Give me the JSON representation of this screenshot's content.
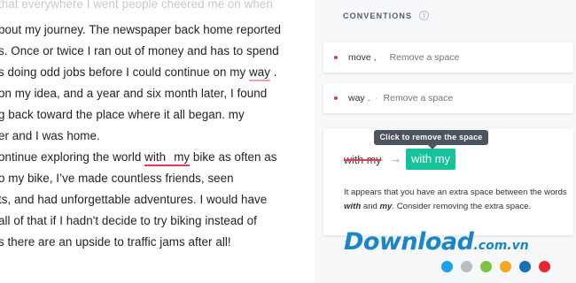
{
  "document": {
    "top_line": "that everywhere I went people cheered me on when",
    "l1": "bout my journey. The newspaper back home reported",
    "l2": "s. Once or twice I ran out of money and has to spend",
    "l3_before": "s doing odd jobs before I could continue on my ",
    "l3_flag": "way",
    "l3_after": " .",
    "l4": "on my idea, and a year and six month later, I found",
    "l5": "g back toward the place where it all began. my",
    "l6": "er and I was home.",
    "l7_before": "ontinue exploring the world ",
    "l7_flag_a": "with",
    "l7_flag_b": "my",
    "l7_after": " bike as often as",
    "l8": "o my bike, I’ve made countless friends, seen",
    "l9": "ts, and had unforgettable adventures. I would have",
    "l10": "all of that if I hadn't decide to try biking instead of",
    "l11": "s there are an upside to traffic jams after all!"
  },
  "panel": {
    "section_title": "CONVENTIONS",
    "info_icon_glyph": "i",
    "cards": [
      {
        "word": "move ,",
        "separator": "·",
        "action": "Remove a space"
      },
      {
        "word": "way .",
        "separator": "·",
        "action": "Remove a space"
      }
    ],
    "expanded": {
      "tooltip": "Click to remove the space",
      "original": "with my",
      "arrow": "→",
      "suggestion": "with my",
      "explanation_1": "It appears that you have an extra space between the words ",
      "explanation_word1": "with",
      "explanation_2": " and ",
      "explanation_word2": "my",
      "explanation_3": ". Consider removing the extra space."
    }
  },
  "watermark": {
    "main": "Download",
    "suffix": ".com.vn",
    "dot_colors": [
      "#1aa3e8",
      "#b9bec4",
      "#7dc242",
      "#f5a623",
      "#1a6fb5",
      "#e8262e"
    ]
  },
  "colors": {
    "accent_green": "#15c39a",
    "error_red": "#e13a54",
    "underline_pink": "#f0a1b0",
    "tooltip_bg": "#4b545f"
  }
}
